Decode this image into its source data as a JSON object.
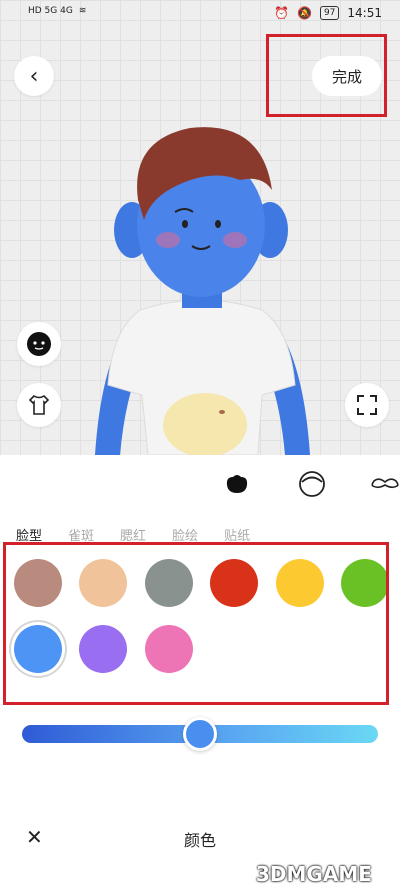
{
  "status_bar": {
    "network_left": "HD 5G 4G",
    "battery": "97",
    "time": "14:51"
  },
  "header": {
    "back_icon": "chevron-left-icon",
    "done_label": "完成"
  },
  "side_buttons": {
    "face": "face-icon",
    "outfit": "shirt-icon",
    "fullscreen": "fullscreen-icon"
  },
  "categories": [
    "face-shape-icon",
    "head-icon",
    "mustache-icon"
  ],
  "tabs": [
    {
      "label": "脸型",
      "active": true
    },
    {
      "label": "雀斑",
      "active": false
    },
    {
      "label": "腮红",
      "active": false
    },
    {
      "label": "脸绘",
      "active": false
    },
    {
      "label": "贴纸",
      "active": false
    }
  ],
  "colors": [
    {
      "hex": "#b88b7e",
      "selected": false
    },
    {
      "hex": "#f0c39a",
      "selected": false
    },
    {
      "hex": "#8a9290",
      "selected": false
    },
    {
      "hex": "#d83318",
      "selected": false
    },
    {
      "hex": "#fdc930",
      "selected": false
    },
    {
      "hex": "#6ac126",
      "selected": false
    },
    {
      "hex": "#4d94f4",
      "selected": true
    },
    {
      "hex": "#9a6ef0",
      "selected": false
    },
    {
      "hex": "#ee75b5",
      "selected": false
    }
  ],
  "slider": {
    "value": 0.5
  },
  "footer": {
    "close_icon": "close-icon",
    "title": "颜色"
  },
  "watermark": "3DMGAME"
}
